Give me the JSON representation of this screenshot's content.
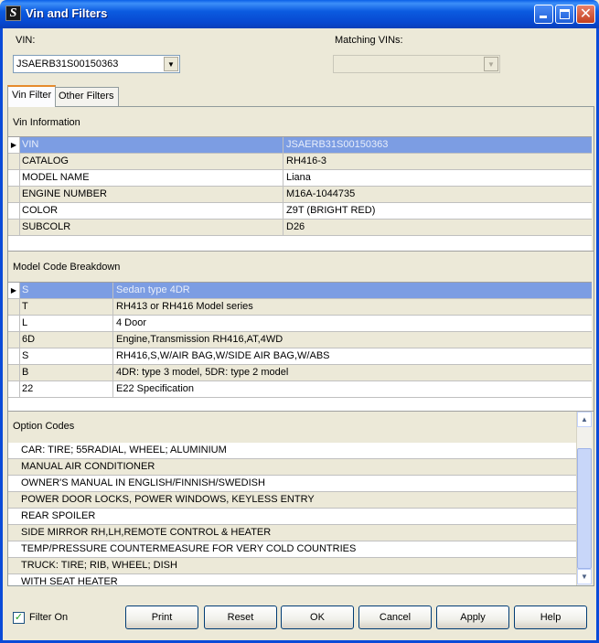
{
  "window": {
    "title": "Vin and Filters",
    "app_icon": "S"
  },
  "vin": {
    "label": "VIN:",
    "value": "JSAERB31S00150363"
  },
  "matching_vins": {
    "label": "Matching VINs:",
    "value": ""
  },
  "tabs": [
    {
      "label": "Vin Filter"
    },
    {
      "label": "Other Filters"
    }
  ],
  "vin_information": {
    "title": "Vin Information",
    "rows": [
      {
        "key": "VIN",
        "value": "JSAERB31S00150363"
      },
      {
        "key": "CATALOG",
        "value": "RH416-3"
      },
      {
        "key": "MODEL NAME",
        "value": "Liana"
      },
      {
        "key": "ENGINE NUMBER",
        "value": "M16A-1044735"
      },
      {
        "key": "COLOR",
        "value": "Z9T (BRIGHT RED)"
      },
      {
        "key": "SUBCOLR",
        "value": "D26"
      }
    ]
  },
  "model_code": {
    "title": "Model Code Breakdown",
    "rows": [
      {
        "code": "S",
        "desc": "Sedan type  4DR"
      },
      {
        "code": "T",
        "desc": "RH413 or RH416 Model series"
      },
      {
        "code": "L",
        "desc": "4 Door"
      },
      {
        "code": "6D",
        "desc": "Engine,Transmission RH416,AT,4WD"
      },
      {
        "code": "S",
        "desc": "RH416,S,W/AIR BAG,W/SIDE AIR BAG,W/ABS"
      },
      {
        "code": "B",
        "desc": "4DR: type 3 model, 5DR: type 2 model"
      },
      {
        "code": "22",
        "desc": "E22 Specification"
      }
    ]
  },
  "option_codes": {
    "title": "Option Codes",
    "rows": [
      "CAR: TIRE; 55RADIAL, WHEEL; ALUMINIUM",
      "MANUAL AIR CONDITIONER",
      "OWNER'S MANUAL IN ENGLISH/FINNISH/SWEDISH",
      "POWER DOOR LOCKS, POWER WINDOWS, KEYLESS ENTRY",
      "REAR SPOILER",
      "SIDE MIRROR RH,LH,REMOTE CONTROL & HEATER",
      "TEMP/PRESSURE COUNTERMEASURE FOR VERY COLD COUNTRIES",
      "TRUCK: TIRE; RIB, WHEEL; DISH",
      "WITH SEAT HEATER"
    ]
  },
  "filter_on": {
    "label": "Filter On",
    "checked": true
  },
  "buttons": {
    "print": "Print",
    "reset": "Reset",
    "ok": "OK",
    "cancel": "Cancel",
    "apply": "Apply",
    "help": "Help"
  }
}
